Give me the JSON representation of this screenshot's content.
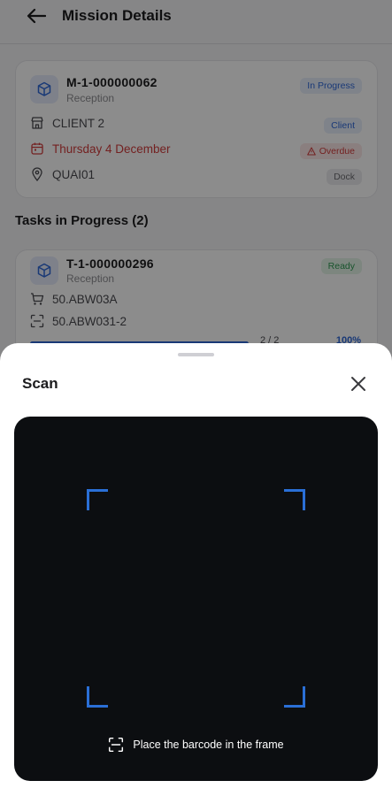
{
  "header": {
    "title": "Mission Details"
  },
  "mission": {
    "code": "M-1-000000062",
    "type": "Reception",
    "status": "In Progress",
    "client": "CLIENT 2",
    "client_tag": "Client",
    "date": "Thursday 4 December",
    "date_tag": "Overdue",
    "location": "QUAI01",
    "location_tag": "Dock"
  },
  "tasks_section": {
    "title": "Tasks in Progress (2)"
  },
  "task": {
    "code": "T-1-000000296",
    "type": "Reception",
    "status": "Ready",
    "location": "50.ABW03A",
    "lot": "50.ABW031-2",
    "progress_fraction": 1.0,
    "progress_count": "2 / 2",
    "progress_percent": "100%"
  },
  "scan_sheet": {
    "title": "Scan",
    "hint": "Place the barcode in the frame"
  },
  "colors": {
    "accent": "#2f68d8",
    "danger": "#d23c3c",
    "success": "#2f9a52",
    "scanner_frame": "#2a6fd6"
  }
}
